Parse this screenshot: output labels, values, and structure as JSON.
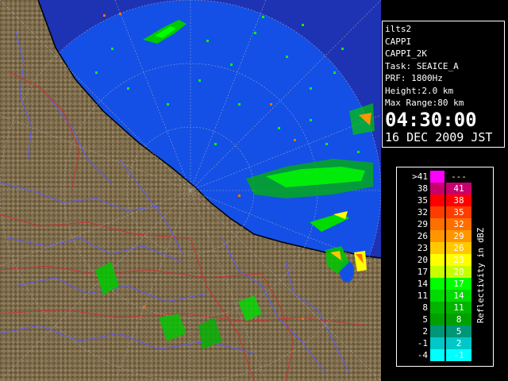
{
  "info": {
    "station": "ilts2",
    "product": "CAPPI",
    "product_variant": "CAPPI_2K",
    "task": "Task: SEAICE_A",
    "prf": "PRF: 1800Hz",
    "height": "Height:2.0 km",
    "max_range": "Max Range:80 km",
    "time": "04:30:00",
    "date": "16 DEC 2009 JST"
  },
  "legend": {
    "title": "Reflectivity in dBZ",
    "rows": [
      {
        "low": ">41",
        "high": "---",
        "color": "#ff00ff"
      },
      {
        "low": "38",
        "high": "41",
        "color": "#c8006e"
      },
      {
        "low": "35",
        "high": "38",
        "color": "#ff0000"
      },
      {
        "low": "32",
        "high": "35",
        "color": "#ff3c00"
      },
      {
        "low": "29",
        "high": "32",
        "color": "#ff6e00"
      },
      {
        "low": "26",
        "high": "29",
        "color": "#ff9600"
      },
      {
        "low": "23",
        "high": "26",
        "color": "#ffc800"
      },
      {
        "low": "20",
        "high": "23",
        "color": "#ffff00"
      },
      {
        "low": "17",
        "high": "20",
        "color": "#c8ff00"
      },
      {
        "low": "14",
        "high": "17",
        "color": "#00ff00"
      },
      {
        "low": "11",
        "high": "14",
        "color": "#00dc00"
      },
      {
        "low": "8",
        "high": "11",
        "color": "#00b400"
      },
      {
        "low": "5",
        "high": "8",
        "color": "#00a000"
      },
      {
        "low": "2",
        "high": "5",
        "color": "#009678"
      },
      {
        "low": "-1",
        "high": "2",
        "color": "#00c8c8"
      },
      {
        "low": "-4",
        "high": "-1",
        "color": "#00ffff"
      }
    ]
  },
  "map": {
    "sea_color": "#1450e6",
    "outside_range_color": "#1e32b4",
    "land_color": "#8a7a5a",
    "rivers_color": "#5a5aff",
    "boundary_color": "#c83232"
  }
}
